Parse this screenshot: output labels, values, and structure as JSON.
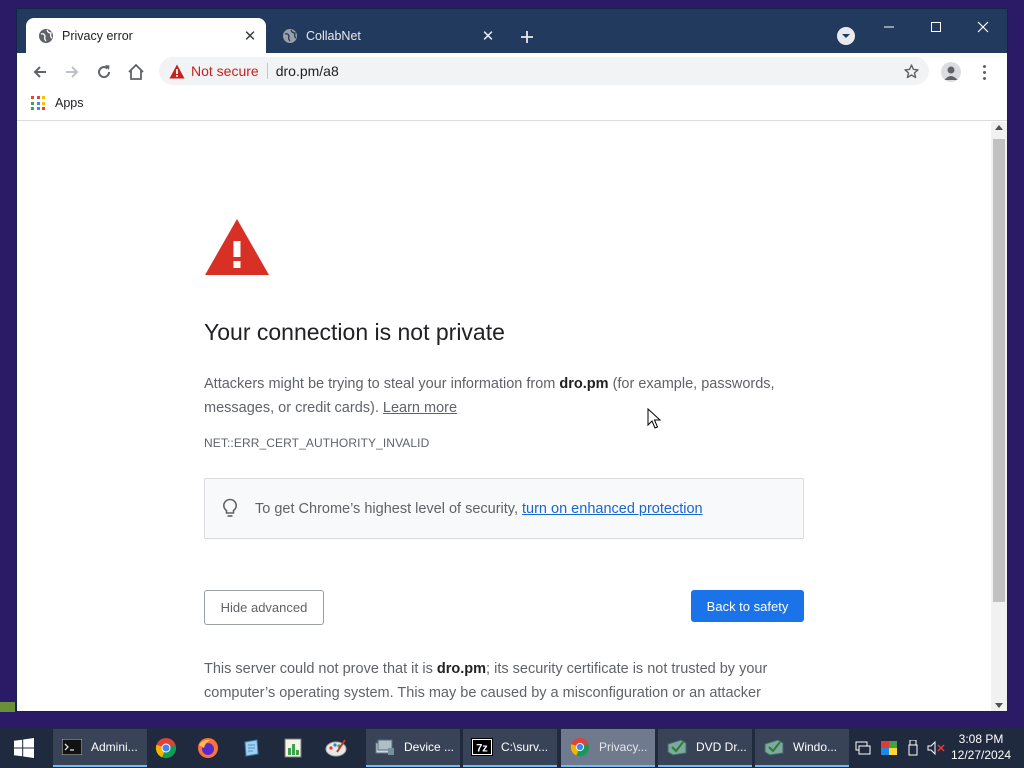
{
  "browser": {
    "tabs": [
      {
        "title": "Privacy error",
        "active": true
      },
      {
        "title": "CollabNet",
        "active": false
      }
    ],
    "address_bar": {
      "security_label": "Not secure",
      "url": "dro.pm/a8"
    },
    "bookmarks": {
      "apps_label": "Apps"
    }
  },
  "page": {
    "heading": "Your connection is not private",
    "explanation_prefix": "Attackers might be trying to steal your information from ",
    "explanation_domain": "dro.pm",
    "explanation_suffix": " (for example, passwords, messages, or credit cards). ",
    "learn_more": "Learn more",
    "error_code": "NET::ERR_CERT_AUTHORITY_INVALID",
    "enhanced_text": "To get Chrome’s highest level of security, ",
    "enhanced_link": "turn on enhanced protection",
    "hide_advanced": "Hide advanced",
    "back_to_safety": "Back to safety",
    "details_prefix": "This server could not prove that it is ",
    "details_domain": "dro.pm",
    "details_suffix": "; its security certificate is not trusted by your computer’s operating system. This may be caused by a misconfiguration or an attacker"
  },
  "taskbar": {
    "items": [
      {
        "label": "Admini...",
        "icon": "terminal-icon"
      },
      {
        "label": "",
        "icon": "chrome-icon"
      },
      {
        "label": "",
        "icon": "firefox-icon"
      },
      {
        "label": "",
        "icon": "notepad-icon"
      },
      {
        "label": "",
        "icon": "chart-app-icon"
      },
      {
        "label": "",
        "icon": "paint-icon"
      },
      {
        "label": "Device ...",
        "icon": "device-manager-icon"
      },
      {
        "label": "C:\\surv...",
        "icon": "7zip-icon"
      },
      {
        "label": "Privacy...",
        "icon": "chrome-icon"
      },
      {
        "label": "DVD Dr...",
        "icon": "drive-icon"
      },
      {
        "label": "Windo...",
        "icon": "window-icon"
      }
    ],
    "clock": {
      "time": "3:08 PM",
      "date": "12/27/2024"
    }
  },
  "colors": {
    "titlebar": "#223a5e",
    "danger": "#d93025",
    "link": "#1967d2",
    "primary_button": "#1a73e8",
    "taskbar": "#1f2a3e"
  }
}
